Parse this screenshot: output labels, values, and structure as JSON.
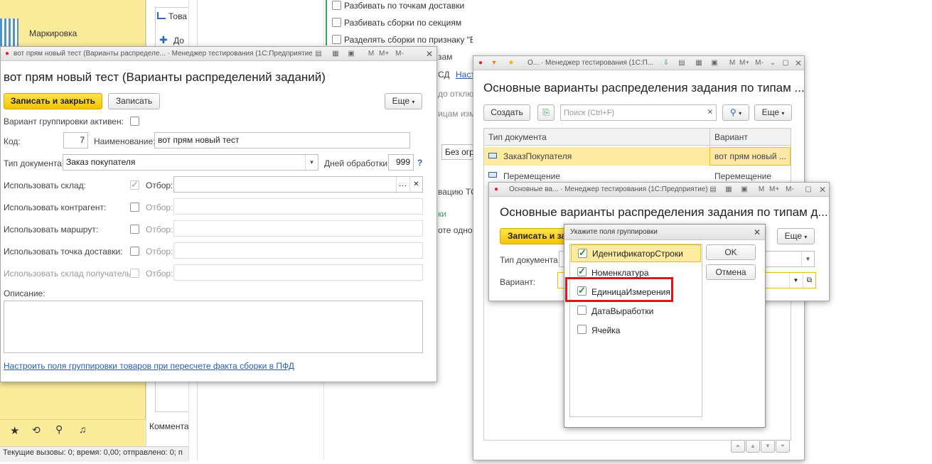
{
  "bg": {
    "left_panel": {
      "marking": "Маркировка",
      "tova": "Това",
      "do": "До",
      "comment": "Коммента"
    },
    "mid_list": [
      "Разбивать по точкам доставки",
      "Разбивать сборки по секциям",
      "Разделять сборки по признаку \"Весовой\""
    ],
    "mid_frag": [
      "зам",
      "СД",
      "Наст",
      "до отклю",
      "ицам изм",
      "Без огр",
      "вацию ТС",
      "ки",
      "оте однов"
    ],
    "status": "Текущие вызовы: 0; время: 0,00; отправлено: 0; п"
  },
  "w1": {
    "title": "вот прям новый тест (Варианты распределе... · Менеджер тестирования (1С:Предприятие)",
    "heading": "вот прям новый тест (Варианты распределений заданий)",
    "save_close": "Записать и закрыть",
    "save": "Записать",
    "more": "Еще",
    "group_active": "Вариант группировки активен:",
    "code_lbl": "Код:",
    "code_val": "7",
    "name_lbl": "Наименование:",
    "name_val": "вот прям новый тест",
    "doctype_lbl": "Тип документа:",
    "doctype_val": "Заказ покупателя",
    "days_lbl": "Дней обработки:",
    "days_val": "999",
    "help": "?",
    "rows": [
      {
        "label": "Использовать склад:",
        "filter": "Отбор:"
      },
      {
        "label": "Использовать контрагент:",
        "filter": "Отбор:"
      },
      {
        "label": "Использовать маршрут:",
        "filter": "Отбор:"
      },
      {
        "label": "Использовать точка доставки:",
        "filter": "Отбор:"
      },
      {
        "label": "Использовать склад получатель:",
        "filter": "Отбор:"
      }
    ],
    "desc_lbl": "Описание:",
    "bottom_link": "Настроить поля группировки товаров при пересчете факта сборки в ПФД"
  },
  "w2": {
    "title": "О... · Менеджер тестирования (1С:П...",
    "heading": "Основные варианты распределения задания по типам ...",
    "create": "Создать",
    "search_placeholder": "Поиск (Ctrl+F)",
    "more": "Еще",
    "col_doc": "Тип документа",
    "col_var": "Вариант",
    "rows": [
      {
        "doc": "ЗаказПокупателя",
        "var": "вот прям новый ..."
      },
      {
        "doc": "Перемещение",
        "var": "Перемещение"
      }
    ]
  },
  "w3": {
    "title": "Основные ва... · Менеджер тестирования (1С:Предприятие)",
    "heading": "Основные варианты распределения задания по типам д...",
    "save_close": "Записать и за",
    "more": "Еще",
    "doctype_lbl": "Тип документа:",
    "variant_lbl": "Вариант:"
  },
  "dlg": {
    "title": "Укажите поля группировки",
    "items": [
      {
        "label": "ИдентификаторСтроки",
        "checked": true
      },
      {
        "label": "Номенклатура",
        "checked": true
      },
      {
        "label": "ЕдиницаИзмерения",
        "checked": true
      },
      {
        "label": "ДатаВыработки",
        "checked": false
      },
      {
        "label": "Ячейка",
        "checked": false
      }
    ],
    "ok": "OK",
    "cancel": "Отмена"
  },
  "colors": {
    "accent_yellow": "#f5c400",
    "highlight_red": "#e0141e",
    "link_blue": "#2a5db0",
    "row_selected": "#fdeba0"
  }
}
